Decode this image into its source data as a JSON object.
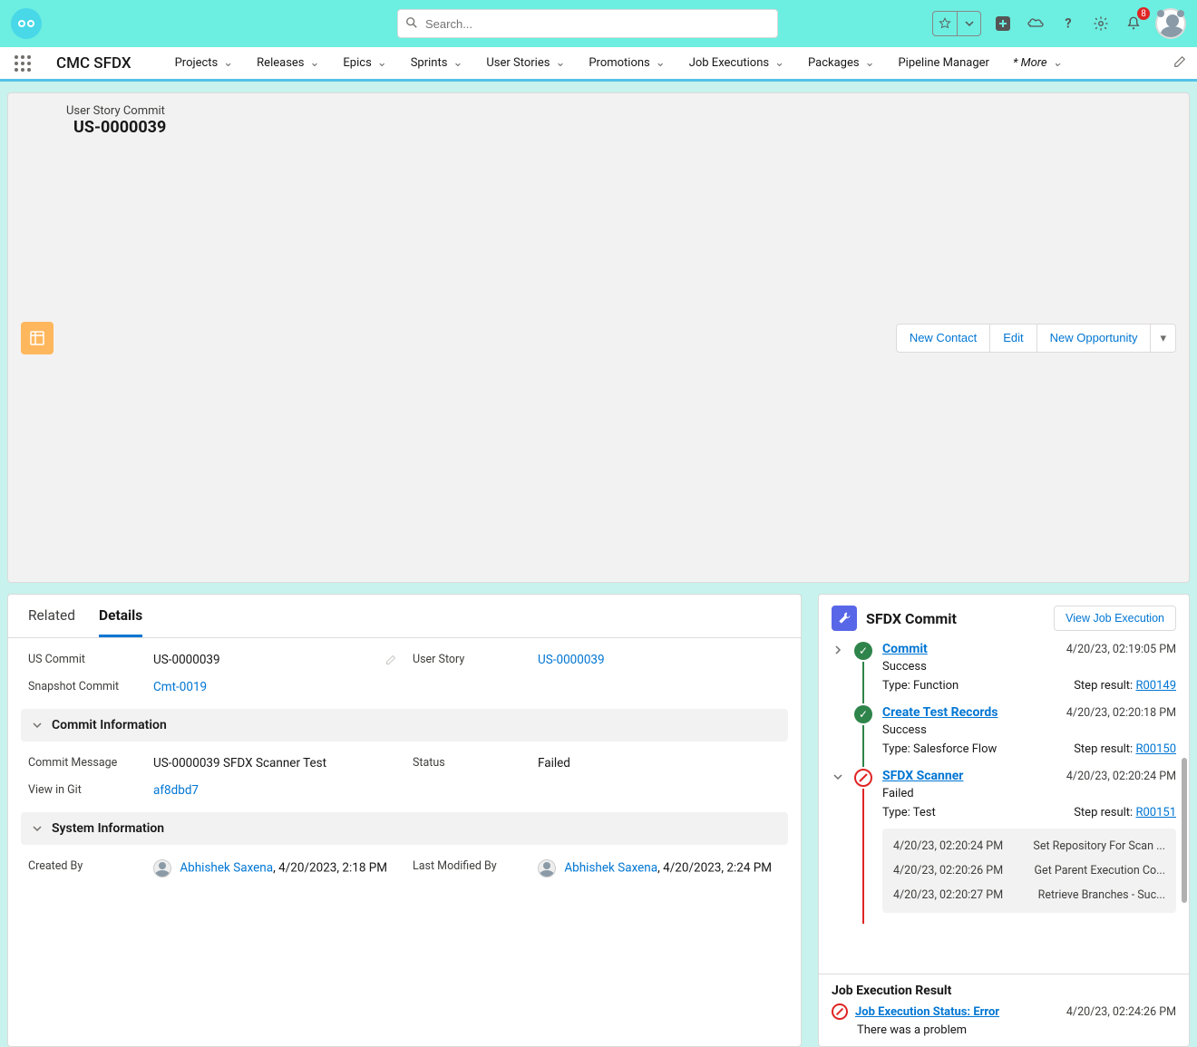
{
  "topbar": {
    "search_placeholder": "Search...",
    "notification_count": "8"
  },
  "nav": {
    "app_name": "CMC SFDX",
    "items": [
      "Projects",
      "Releases",
      "Epics",
      "Sprints",
      "User Stories",
      "Promotions",
      "Job Executions",
      "Packages",
      "Pipeline Manager"
    ],
    "more": "* More"
  },
  "page_header": {
    "subtitle": "User Story Commit",
    "title": "US-0000039",
    "buttons": {
      "new_contact": "New Contact",
      "edit": "Edit",
      "new_opportunity": "New Opportunity"
    }
  },
  "tabs": {
    "related": "Related",
    "details": "Details"
  },
  "details": {
    "us_commit": {
      "label": "US Commit",
      "value": "US-0000039"
    },
    "user_story": {
      "label": "User Story",
      "value": "US-0000039"
    },
    "snapshot_commit": {
      "label": "Snapshot Commit",
      "value": "Cmt-0019"
    },
    "sections": {
      "commit_info": "Commit Information",
      "system_info": "System Information"
    },
    "commit_message": {
      "label": "Commit Message",
      "value": "US-0000039 SFDX Scanner Test"
    },
    "status": {
      "label": "Status",
      "value": "Failed"
    },
    "view_in_git": {
      "label": "View in Git",
      "value": "af8dbd7"
    },
    "created_by": {
      "label": "Created By",
      "user": "Abhishek Saxena",
      "at": ", 4/20/2023, 2:18 PM"
    },
    "last_modified_by": {
      "label": "Last Modified By",
      "user": "Abhishek Saxena",
      "at": ", 4/20/2023, 2:24 PM"
    }
  },
  "right": {
    "title": "SFDX Commit",
    "view_btn": "View Job Execution",
    "steps": [
      {
        "name": "Commit",
        "time": "4/20/23, 02:19:05 PM",
        "status": "Success",
        "type_label": "Type:",
        "type": "Function",
        "result_label": "Step result:",
        "result": "R00149"
      },
      {
        "name": "Create Test Records",
        "time": "4/20/23, 02:20:18 PM",
        "status": "Success",
        "type_label": "Type:",
        "type": "Salesforce Flow",
        "result_label": "Step result:",
        "result": "R00150"
      },
      {
        "name": "SFDX Scanner",
        "time": "4/20/23, 02:20:24 PM",
        "status": "Failed",
        "type_label": "Type:",
        "type": "Test",
        "result_label": "Step result:",
        "result": "R00151"
      }
    ],
    "substeps": [
      {
        "time": "4/20/23, 02:20:24 PM",
        "text": "Set Repository For Scan ..."
      },
      {
        "time": "4/20/23, 02:20:26 PM",
        "text": "Get Parent Execution Co..."
      },
      {
        "time": "4/20/23, 02:20:27 PM",
        "text": "Retrieve Branches - Suc..."
      }
    ],
    "result": {
      "title": "Job Execution Result",
      "status": "Job Execution Status: Error",
      "time": "4/20/23, 02:24:26 PM",
      "message": "There was a problem"
    }
  }
}
